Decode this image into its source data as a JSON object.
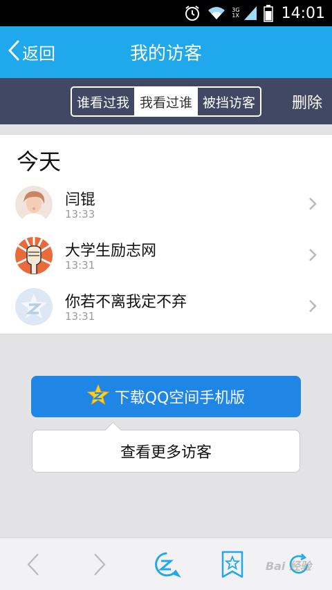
{
  "status_bar": {
    "time": "14:01",
    "network_top": "3G",
    "network_bottom": "1X",
    "icons": [
      "alarm-clock-icon",
      "wifi-icon",
      "signal-icon",
      "battery-icon"
    ]
  },
  "header": {
    "back_label": "返回",
    "title": "我的访客"
  },
  "tabs": {
    "items": [
      {
        "label": "谁看过我"
      },
      {
        "label": "我看过谁",
        "active": true
      },
      {
        "label": "被挡访客"
      }
    ],
    "delete_label": "删除"
  },
  "visitors": {
    "section_title": "今天",
    "items": [
      {
        "name": "闫锟",
        "time": "13:33",
        "avatar": "portrait-avatar"
      },
      {
        "name": "大学生励志网",
        "time": "13:31",
        "avatar": "raised-fist-avatar"
      },
      {
        "name": "你若不离我定不弃",
        "time": "13:31",
        "avatar": "qzone-default-avatar"
      }
    ]
  },
  "actions": {
    "download_label": "下载QQ空间手机版",
    "more_label": "查看更多访客"
  },
  "toolbar": {
    "icons": [
      "back-arrow-icon",
      "forward-arrow-icon",
      "qzone-home-icon",
      "bookmark-star-icon",
      "refresh-icon"
    ]
  },
  "watermark": "Bai 经验",
  "colors": {
    "header_bg": "#1fa9ec",
    "tab_bar_bg": "#404863",
    "download_button_bg": "#1f86e6"
  }
}
